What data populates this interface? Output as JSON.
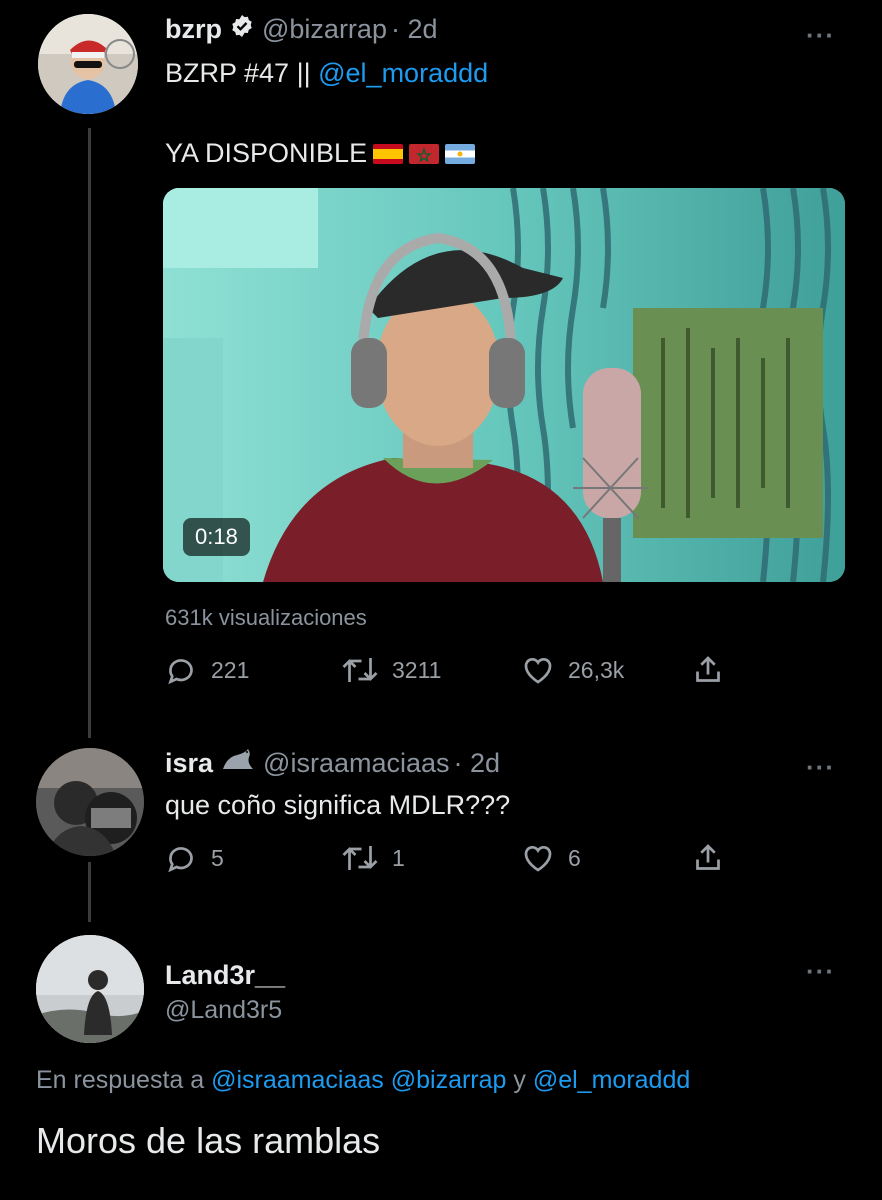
{
  "tweet1": {
    "name": "bzrp",
    "handle": "@bizarrap",
    "time": "· 2d",
    "title_prefix": "BZRP #47 ||",
    "title_mention": "@el_moraddd",
    "body_text": "YA DISPONIBLE",
    "flags": [
      "spain-flag",
      "morocco-flag",
      "argentina-flag"
    ],
    "video_duration": "0:18",
    "views": "631k visualizaciones",
    "replies": "221",
    "retweets": "3211",
    "likes": "26,3k"
  },
  "tweet2": {
    "name": "isra",
    "emoji": "seal-emoji",
    "handle": "@israamaciaas",
    "time": "· 2d",
    "text": "que coño significa MDLR???",
    "replies": "5",
    "retweets": "1",
    "likes": "6"
  },
  "tweet3": {
    "name": "Land3r__",
    "handle": "@Land3r5",
    "reply_prefix": "En respuesta a",
    "reply_mentions": "@israamaciaas @bizarrap",
    "reply_conjunction": "y",
    "reply_mention_last": "@el_moraddd",
    "text": "Moros de las ramblas"
  },
  "colors": {
    "background": "#000000",
    "link": "#1d9bf0",
    "muted": "#8b949e"
  }
}
